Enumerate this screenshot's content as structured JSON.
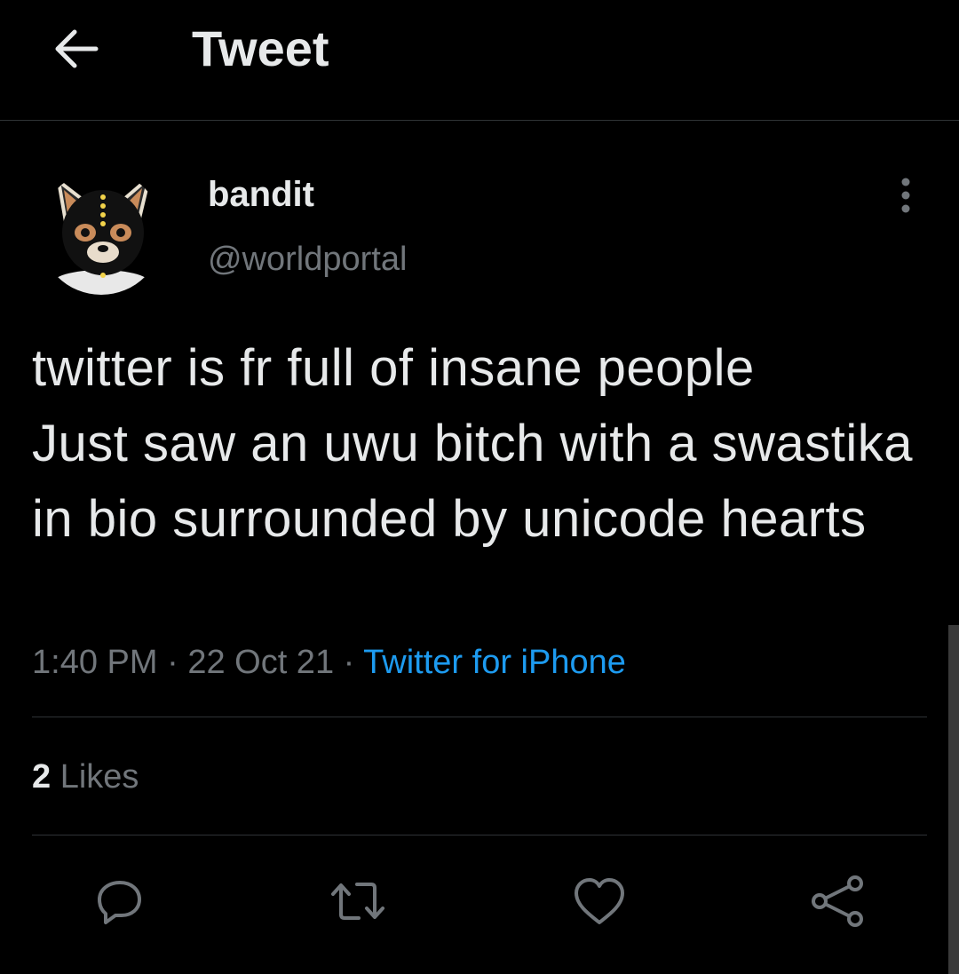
{
  "header": {
    "title": "Tweet",
    "back_icon": "arrow-left-icon"
  },
  "author": {
    "display_name": "bandit",
    "handle": "@worldportal",
    "avatar": "masked-dog-avatar"
  },
  "tweet": {
    "text": "twitter is fr full of insane people\nJust saw an uwu bitch with a swastika in bio surrounded by unicode hearts",
    "time": "1:40 PM",
    "date": "22 Oct 21",
    "source": "Twitter for iPhone",
    "separator": "·"
  },
  "engagement": {
    "likes_count": "2",
    "likes_label": "Likes"
  },
  "actions": {
    "reply_icon": "reply-icon",
    "retweet_icon": "retweet-icon",
    "like_icon": "heart-icon",
    "share_icon": "share-icon"
  },
  "colors": {
    "background": "#000000",
    "text": "#e7e9ea",
    "muted": "#71767b",
    "accent": "#1d9bf0",
    "divider": "#2f3336"
  }
}
